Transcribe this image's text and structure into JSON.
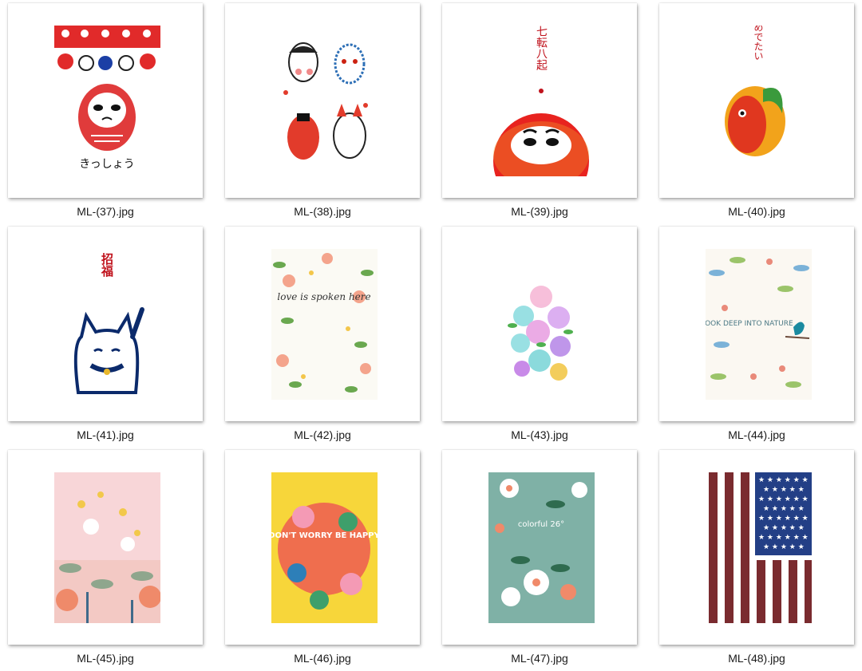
{
  "files": [
    {
      "name": "ML-(37).jpg",
      "art": "daruma-kisshou",
      "text": "きっしょう"
    },
    {
      "name": "ML-(38).jpg",
      "art": "masks",
      "text": ""
    },
    {
      "name": "ML-(39).jpg",
      "art": "daruma-nanakorobi",
      "text": "七転八起"
    },
    {
      "name": "ML-(40).jpg",
      "art": "tai-fish",
      "text": "めでたい"
    },
    {
      "name": "ML-(41).jpg",
      "art": "maneki-neko",
      "text": "招福"
    },
    {
      "name": "ML-(42).jpg",
      "art": "floral-love",
      "text": "love is spoken here"
    },
    {
      "name": "ML-(43).jpg",
      "art": "floral-roses",
      "text": ""
    },
    {
      "name": "ML-(44).jpg",
      "art": "nature-bird",
      "text": "LOOK DEEP INTO NATURE"
    },
    {
      "name": "ML-(45).jpg",
      "art": "pink-garden",
      "text": ""
    },
    {
      "name": "ML-(46).jpg",
      "art": "dont-worry",
      "text": "DON'T WORRY BE HAPPY"
    },
    {
      "name": "ML-(47).jpg",
      "art": "colorful-26",
      "text": "colorful 26°"
    },
    {
      "name": "ML-(48).jpg",
      "art": "us-flag",
      "text": ""
    }
  ]
}
